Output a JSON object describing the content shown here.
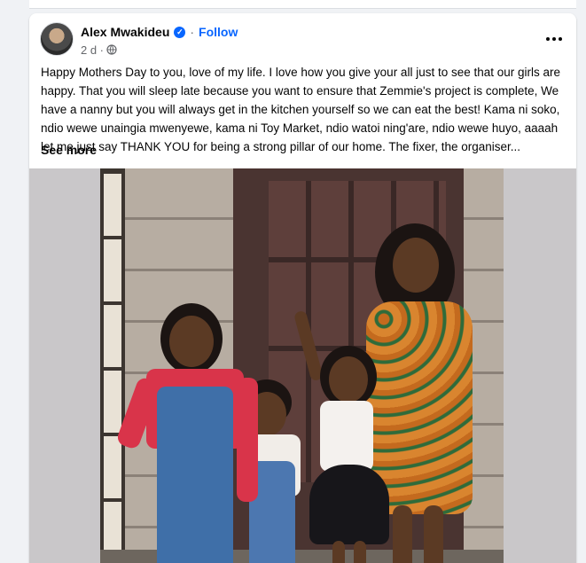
{
  "post": {
    "author": "Alex Mwakideu",
    "separator": "·",
    "follow_label": "Follow",
    "time": "2 d ·",
    "text": "Happy Mothers Day to you, love of my life. I love how you give your all just to see that our girls are happy. That you will sleep late because you want to ensure that Zemmie's project is complete, We have a nanny but you will always get in the kitchen yourself so we can eat the best! Kama ni soko, ndio wewe unaingia mwenyewe, kama ni Toy Market, ndio watoi ning'are, ndio wewe huyo, aaaah let me just say THANK YOU for being a strong pillar of our home. The fixer, the organiser...",
    "see_more_label": "See more",
    "icons": {
      "verified": "verified-badge-icon",
      "audience": "globe-icon",
      "more": "more-options-icon"
    }
  },
  "colors": {
    "accent": "#0866ff",
    "text": "#050505",
    "secondary_text": "#65676b",
    "background": "#f0f2f5"
  }
}
